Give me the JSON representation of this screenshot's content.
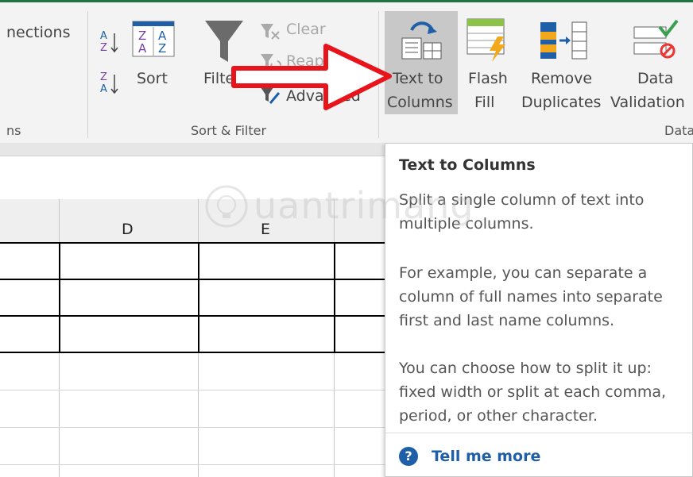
{
  "ribbon": {
    "connections_label": "nections",
    "connections_group": "ns",
    "sort_label": "Sort",
    "filter_label": "Filter",
    "clear_label": "Clear",
    "reapply_label": "Reapply",
    "advanced_label": "Advanced",
    "sort_filter_group": "Sort & Filter",
    "text_to_columns_line1": "Text to",
    "text_to_columns_line2": "Columns",
    "flash_fill_line1": "Flash",
    "flash_fill_line2": "Fill",
    "remove_duplicates_line1": "Remove",
    "remove_duplicates_line2": "Duplicates",
    "data_validation_line1": "Data",
    "data_validation_line2": "Validation",
    "data_tools_group": "Data"
  },
  "sheet": {
    "columns": [
      "D",
      "E"
    ]
  },
  "tooltip": {
    "title": "Text to Columns",
    "para1": "Split a single column of text into multiple columns.",
    "para2": "For example, you can separate a column of full names into separate first and last name columns.",
    "para3": "You can choose how to split it up: fixed width or split at each comma, period, or other character.",
    "help_glyph": "?",
    "link": "Tell me more"
  },
  "watermark": "uantrimang",
  "colors": {
    "accent_green": "#217346",
    "arrow_red": "#e8141b",
    "link_blue": "#1e5fa8"
  },
  "icons": [
    "sort-az-icon",
    "sort-za-icon",
    "sort-dialog-icon",
    "filter-funnel-icon",
    "clear-filter-icon",
    "reapply-icon",
    "advanced-filter-icon",
    "text-to-columns-icon",
    "flash-fill-icon",
    "remove-duplicates-icon",
    "data-validation-icon",
    "help-icon"
  ]
}
